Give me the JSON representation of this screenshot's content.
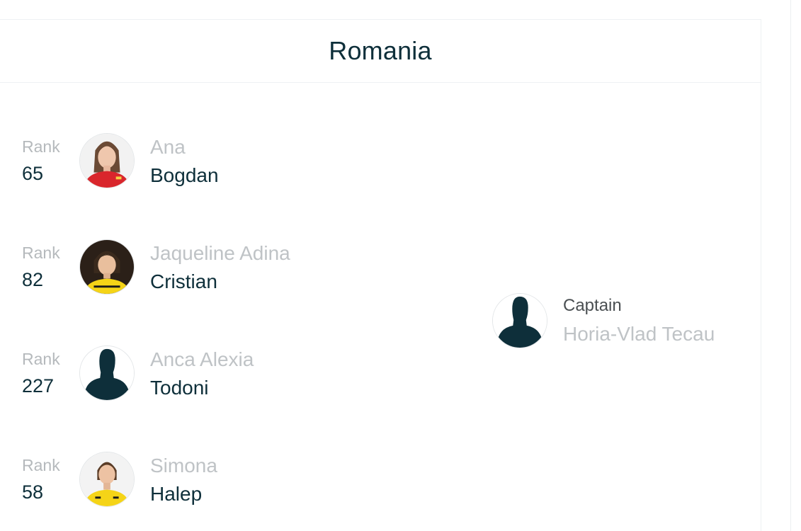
{
  "team": {
    "name": "Romania"
  },
  "players": [
    {
      "rank_label": "Rank",
      "rank": "65",
      "first_name": "Ana",
      "last_name": "Bogdan",
      "photo": "photo-red-kit"
    },
    {
      "rank_label": "Rank",
      "rank": "82",
      "first_name": "Jaqueline Adina",
      "last_name": "Cristian",
      "photo": "photo-yellow-kit"
    },
    {
      "rank_label": "Rank",
      "rank": "227",
      "first_name": "Anca Alexia",
      "last_name": "Todoni",
      "photo": "silhouette-icon"
    },
    {
      "rank_label": "Rank",
      "rank": "58",
      "first_name": "Simona",
      "last_name": "Halep",
      "photo": "photo-yellow-kit"
    }
  ],
  "captain": {
    "label": "Captain",
    "name": "Horia-Vlad Tecau",
    "photo": "silhouette-icon"
  },
  "colors": {
    "dark": "#0e2f3a",
    "muted": "#bfc3c6",
    "rank_label": "#b5b9bc",
    "border": "#eef1f3"
  }
}
